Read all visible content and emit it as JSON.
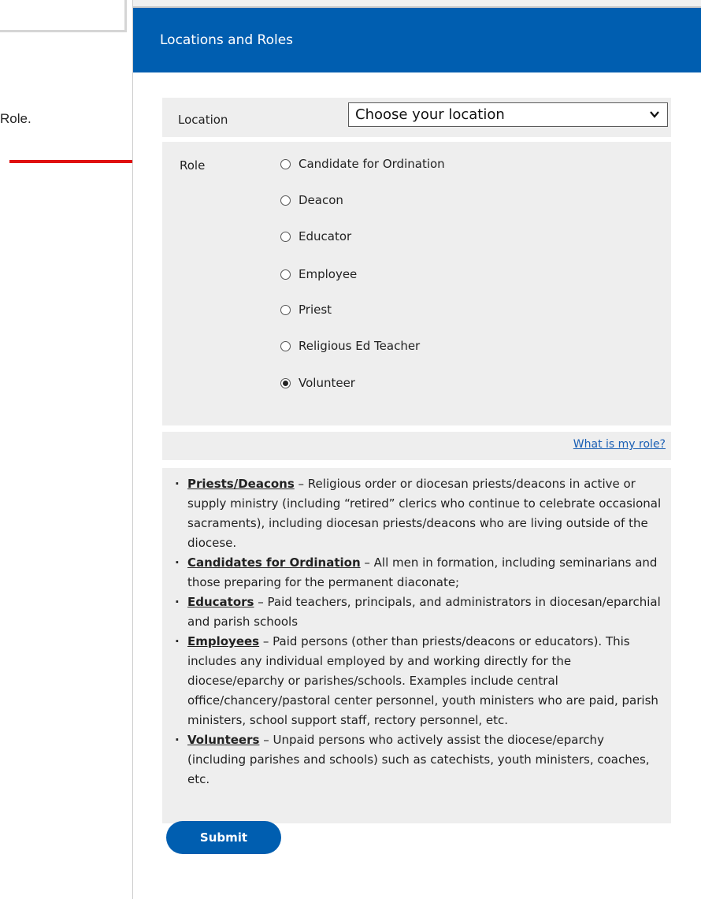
{
  "left": {
    "note_text": "Role."
  },
  "panel": {
    "title": "Locations and Roles"
  },
  "location": {
    "label": "Location",
    "selected": "Choose your location"
  },
  "role": {
    "label": "Role",
    "options": [
      {
        "label": "Candidate for Ordination",
        "checked": false
      },
      {
        "label": "Deacon",
        "checked": false
      },
      {
        "label": "Educator",
        "checked": false
      },
      {
        "label": "Employee",
        "checked": false
      },
      {
        "label": "Priest",
        "checked": false
      },
      {
        "label": "Religious Ed Teacher",
        "checked": false
      },
      {
        "label": "Volunteer",
        "checked": true
      }
    ]
  },
  "help": {
    "link_text": "What is my role?"
  },
  "definitions": [
    {
      "term": "Priests/Deacons",
      "text": " – Religious order or diocesan priests/deacons in active or supply ministry (including “retired” clerics who continue to celebrate occasional sacraments), including diocesan priests/deacons who are living outside of the diocese."
    },
    {
      "term": "Candidates for Ordination",
      "text": " – All men in formation, including seminarians and those preparing for the permanent diaconate;"
    },
    {
      "term": "Educators",
      "text": " – Paid teachers, principals, and administrators in diocesan/eparchial and parish schools"
    },
    {
      "term": "Employees",
      "text": " – Paid persons (other than priests/deacons or educators). This includes any individual employed by and working directly for the diocese/eparchy or parishes/schools. Examples include central office/chancery/pastoral center personnel, youth ministers who are paid, parish ministers, school support staff, rectory personnel, etc."
    },
    {
      "term": "Volunteers",
      "text": " – Unpaid persons who actively assist the diocese/eparchy (including parishes and schools) such as catechists, youth ministers, coaches, etc."
    }
  ],
  "submit": {
    "label": "Submit"
  },
  "colors": {
    "header_blue": "#005eb0",
    "annotation_red": "#e01010",
    "card_gray": "#eeeeee",
    "link_blue": "#1a5fb4"
  },
  "icons": {
    "select_arrow": "chevron-down-icon",
    "annotation_arrows": "red-arrow-icon"
  }
}
